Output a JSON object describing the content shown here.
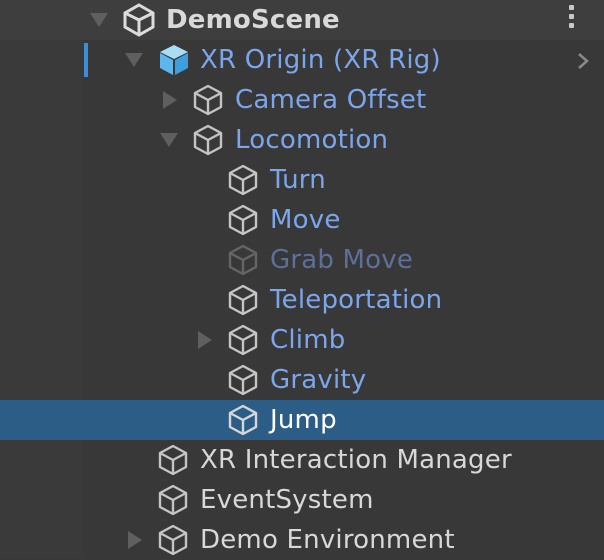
{
  "scene": {
    "name": "DemoScene",
    "icon": "unity-logo-icon",
    "menu_icon": "kebab-menu-icon"
  },
  "items": [
    {
      "label": "XR Origin (XR Rig)",
      "depth": 1,
      "expanded": true,
      "icon": "prefab-cube-icon",
      "style": "prefab"
    },
    {
      "label": "Camera Offset",
      "depth": 2,
      "expanded": false,
      "icon": "gameobject-cube-icon",
      "style": "prefab-child"
    },
    {
      "label": "Locomotion",
      "depth": 2,
      "expanded": true,
      "icon": "gameobject-cube-icon",
      "style": "prefab-child"
    },
    {
      "label": "Turn",
      "depth": 3,
      "icon": "gameobject-cube-icon",
      "style": "prefab-child"
    },
    {
      "label": "Move",
      "depth": 3,
      "icon": "gameobject-cube-icon",
      "style": "prefab-child"
    },
    {
      "label": "Grab Move",
      "depth": 3,
      "icon": "gameobject-cube-icon",
      "style": "inactive"
    },
    {
      "label": "Teleportation",
      "depth": 3,
      "icon": "gameobject-cube-icon",
      "style": "prefab-child"
    },
    {
      "label": "Climb",
      "depth": 3,
      "expanded": false,
      "icon": "gameobject-cube-icon",
      "style": "prefab-child"
    },
    {
      "label": "Gravity",
      "depth": 3,
      "icon": "gameobject-cube-icon",
      "style": "prefab-child"
    },
    {
      "label": "Jump",
      "depth": 3,
      "icon": "gameobject-cube-icon",
      "style": "selected"
    },
    {
      "label": "XR Interaction Manager",
      "depth": 1,
      "icon": "gameobject-cube-icon",
      "style": "normal"
    },
    {
      "label": "EventSystem",
      "depth": 1,
      "icon": "gameobject-cube-icon",
      "style": "normal"
    },
    {
      "label": "Demo Environment",
      "depth": 1,
      "expanded": false,
      "icon": "gameobject-cube-icon",
      "style": "normal"
    }
  ],
  "colors": {
    "background": "#383838",
    "selection": "#2c5d87",
    "prefab_text": "#7ba6ec",
    "prefab_bar": "#3b8fd8",
    "normal_text": "#d8d8d8"
  }
}
